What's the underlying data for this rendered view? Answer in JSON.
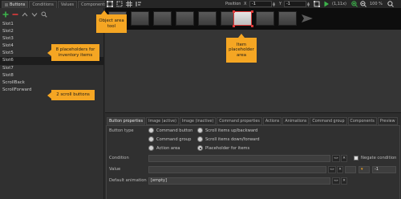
{
  "left_panel": {
    "tabs": [
      "Buttons",
      "Conditions",
      "Values",
      "Components"
    ],
    "items": [
      "Slot1",
      "Slot2",
      "Slot3",
      "Slot4",
      "Slot5",
      "Slot6",
      "Slot7",
      "Slot8",
      "ScrollBack",
      "ScrollForward"
    ],
    "selected_index": 5
  },
  "callouts": {
    "placeholders": "8 placeholders for inventory items",
    "scroll": "2 scroll buttons",
    "area_tool": "Object area tool",
    "item_area": "Item placeholder area"
  },
  "toolbar": {
    "position_label": "Position",
    "x_label": "X",
    "x_value": "-1",
    "y_label": "Y",
    "y_value": "-1",
    "zoom_text": "(1,11x)",
    "zoom_percent": "100 %"
  },
  "properties": {
    "tabs": [
      "Button properties",
      "Image (active)",
      "Image (inactive)",
      "Command properties",
      "Actions",
      "Animations",
      "Command group",
      "Components",
      "Preview"
    ],
    "button_type_label": "Button type",
    "radio_options": [
      "Command button",
      "Command group",
      "Action area",
      "Scroll items up/backward",
      "Scroll items down/forward",
      "Placeholder for items"
    ],
    "selected_option": "Placeholder for items",
    "condition_label": "Condition",
    "negate_label": "Negate condition",
    "value_label": "Value",
    "value_number": "-1",
    "default_animation_label": "Default animation",
    "default_animation_value": "[empty]",
    "small_button_label": "«»"
  },
  "colors": {
    "callout": "#f5a623",
    "selection": "#e03a3a",
    "add": "#3cb44b",
    "remove": "#e03a3a",
    "play": "#3cb44b",
    "zoom_in": "#3cb44b"
  }
}
